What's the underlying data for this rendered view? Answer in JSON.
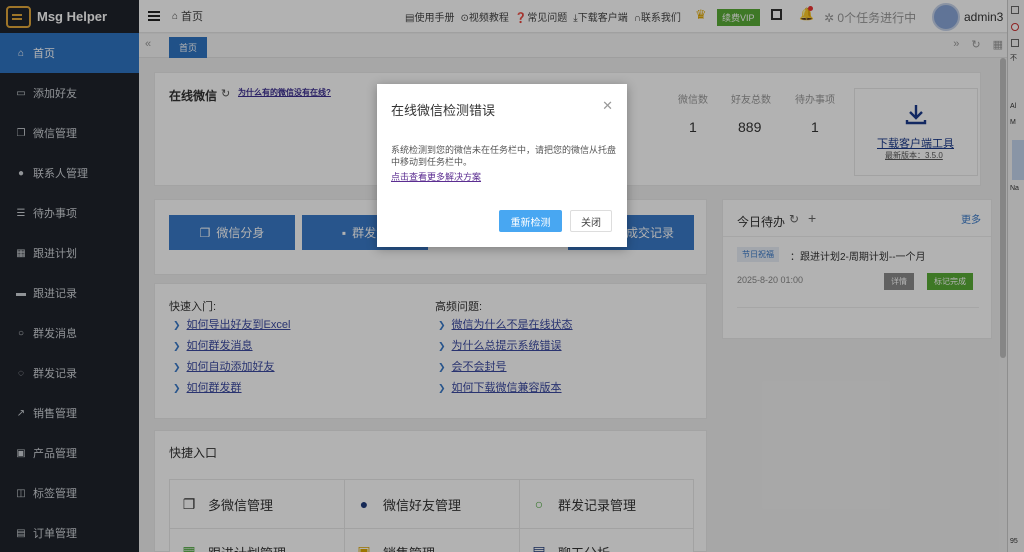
{
  "app": {
    "name": "Msg Helper"
  },
  "sidebar": {
    "items": [
      {
        "label": "首页",
        "icon": "home-icon"
      },
      {
        "label": "添加好友",
        "icon": "id-card-icon"
      },
      {
        "label": "微信管理",
        "icon": "copy-icon"
      },
      {
        "label": "联系人管理",
        "icon": "user-icon"
      },
      {
        "label": "待办事项",
        "icon": "list-icon"
      },
      {
        "label": "跟进计划",
        "icon": "calendar-icon"
      },
      {
        "label": "跟进记录",
        "icon": "briefcase-icon"
      },
      {
        "label": "群发消息",
        "icon": "chat-icon"
      },
      {
        "label": "群发记录",
        "icon": "chat-dots-icon"
      },
      {
        "label": "销售管理",
        "icon": "chart-icon"
      },
      {
        "label": "产品管理",
        "icon": "box-icon"
      },
      {
        "label": "标签管理",
        "icon": "bookmark-icon"
      },
      {
        "label": "订单管理",
        "icon": "order-icon"
      }
    ]
  },
  "topbar": {
    "breadcrumb": "首页",
    "links": [
      "使用手册",
      "视频教程",
      "常见问题",
      "下载客户端",
      "联系我们"
    ],
    "vip": "续费VIP",
    "tasks": "0个任务进行中",
    "username": "admin3"
  },
  "tabs": {
    "home": "首页"
  },
  "online": {
    "title": "在线微信",
    "why_link": "为什么有的微信没有在线?",
    "stats": [
      {
        "label": "微信数",
        "value": "1"
      },
      {
        "label": "好友总数",
        "value": "889"
      },
      {
        "label": "待办事项",
        "value": "1"
      }
    ],
    "download": {
      "label": "下载客户端工具",
      "version": "最新版本：3.5.0"
    }
  },
  "actions": {
    "wx_split": "微信分身",
    "mass_send": "群发消",
    "deal_record": "成交记录"
  },
  "quick_start": {
    "title": "快速入门:",
    "links": [
      "如何导出好友到Excel",
      "如何群发消息",
      "如何自动添加好友",
      "如何群发群"
    ]
  },
  "faq": {
    "title": "高频问题:",
    "links": [
      "微信为什么不是在线状态",
      "为什么总提示系统错误",
      "会不会封号",
      "如何下载微信兼容版本"
    ]
  },
  "quick_entry": {
    "title": "快捷入口",
    "items": [
      "多微信管理",
      "微信好友管理",
      "群发记录管理",
      "跟进计划管理",
      "销售管理",
      "聊天分析"
    ]
  },
  "todo": {
    "title": "今日待办",
    "more": "更多",
    "tag": "节日祝福",
    "text": "：跟进计划2-周期计划--一个月",
    "date": "2025-8-20 01:00",
    "detail": "详情",
    "done": "标记完成"
  },
  "dialog": {
    "title": "在线微信检测错误",
    "body": "系统检测到您的微信未在任务栏中，请把您的微信从托盘中移动到任务栏中。",
    "link": "点击查看更多解决方案",
    "recheck": "重新检测",
    "close": "关闭"
  },
  "right_panel": {
    "letters": [
      "不",
      "Al",
      "M",
      "Na",
      "95"
    ]
  },
  "colors": {
    "sidebar": "#1f232c",
    "accent": "#2f74c3",
    "vip": "#5aac37",
    "dialog_button": "#48a7f2"
  }
}
